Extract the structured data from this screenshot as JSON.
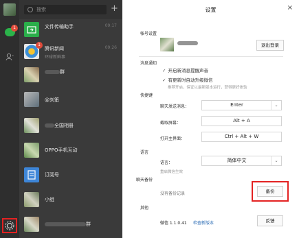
{
  "search": {
    "placeholder": "搜索"
  },
  "chats": [
    {
      "name": "文件传输助手",
      "time": "09:17"
    },
    {
      "name": "腾讯新闻",
      "time": "09:26",
      "badge": "1",
      "preview": "环球新鲜事"
    },
    {
      "name": "群"
    },
    {
      "name": "@刘策"
    },
    {
      "name": "全国相册"
    },
    {
      "name": "OPPO手机互动"
    },
    {
      "name": "订阅号"
    },
    {
      "name": "小组"
    },
    {
      "name": "群"
    }
  ],
  "unread_badge": "1",
  "settings": {
    "title": "设置",
    "close": "×",
    "account": {
      "label": "帐号设置",
      "logout": "退出登录"
    },
    "notify": {
      "label": "消息通知",
      "opt1": "开启新消息提醒声音",
      "opt2": "有更新时自动升级微信",
      "hint": "推荐开启，保证以最新版本运行，获得更好体验"
    },
    "shortcut": {
      "label": "快捷键",
      "send_label": "聊天发送消息：",
      "send_value": "Enter",
      "capture_label": "截取屏幕：",
      "capture_value": "Alt + A",
      "open_label": "打开主界面：",
      "open_value": "Ctrl + Alt + W"
    },
    "language": {
      "label": "语言",
      "field": "语言：",
      "value": "简体中文",
      "hint": "重启微信生效"
    },
    "backup": {
      "label": "聊天备份",
      "status": "没有备份记录",
      "button": "备份"
    },
    "other": {
      "label": "其他",
      "version": "微信 1.1.0.41",
      "check": "检查新版本",
      "feedback": "反馈"
    }
  },
  "colors": {
    "sidebar": "#2e2e2e",
    "list": "#3a3a3a",
    "highlight": "#e32222",
    "link": "#2b6cb5",
    "badge": "#e04b3a"
  }
}
